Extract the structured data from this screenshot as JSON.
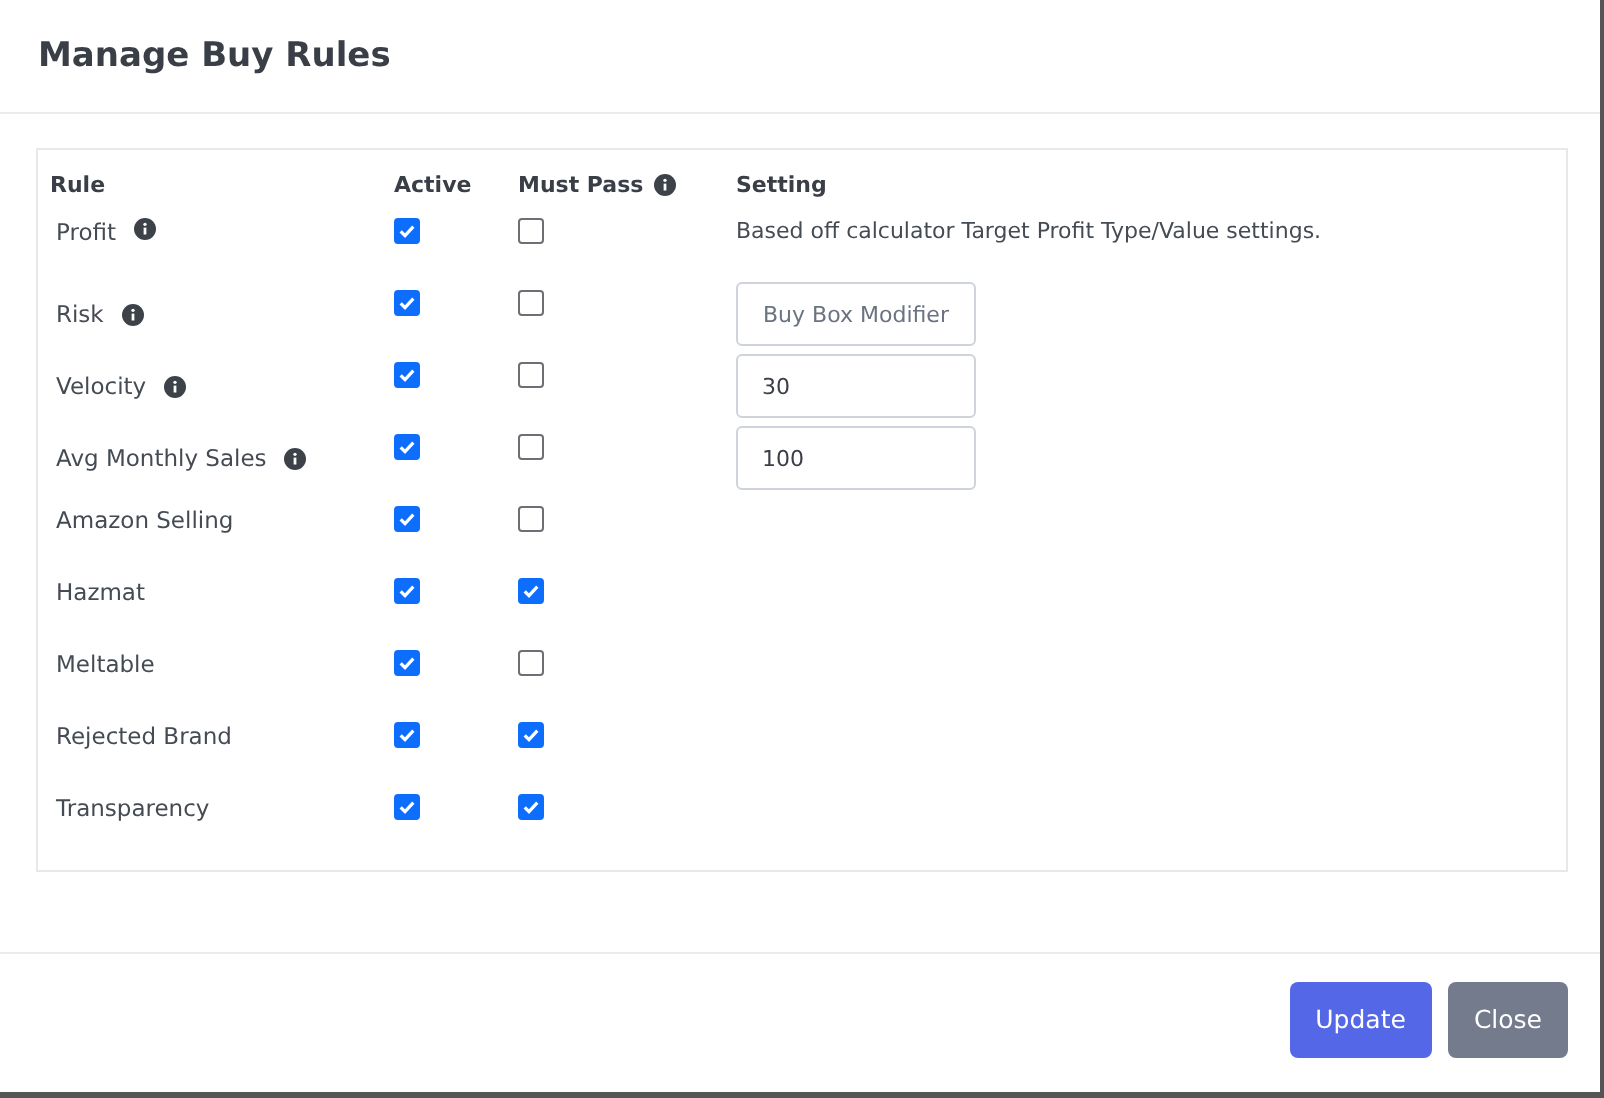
{
  "modal": {
    "title": "Manage Buy Rules"
  },
  "table": {
    "columns": [
      {
        "label": "Rule",
        "info": false
      },
      {
        "label": "Active",
        "info": false
      },
      {
        "label": "Must Pass",
        "info": true
      },
      {
        "label": "Setting",
        "info": false
      }
    ],
    "rows": [
      {
        "rule": "Profit",
        "info": true,
        "active": true,
        "must_pass": false,
        "setting": {
          "kind": "text",
          "text": "Based off calculator Target Profit Type/Value settings."
        }
      },
      {
        "rule": "Risk",
        "info": true,
        "active": true,
        "must_pass": false,
        "setting": {
          "kind": "button",
          "label": "Buy Box Modifier"
        }
      },
      {
        "rule": "Velocity",
        "info": true,
        "active": true,
        "must_pass": false,
        "setting": {
          "kind": "input",
          "value": "30"
        }
      },
      {
        "rule": "Avg Monthly Sales",
        "info": true,
        "active": true,
        "must_pass": false,
        "setting": {
          "kind": "input",
          "value": "100"
        }
      },
      {
        "rule": "Amazon Selling",
        "info": false,
        "active": true,
        "must_pass": false
      },
      {
        "rule": "Hazmat",
        "info": false,
        "active": true,
        "must_pass": true
      },
      {
        "rule": "Meltable",
        "info": false,
        "active": true,
        "must_pass": false
      },
      {
        "rule": "Rejected Brand",
        "info": false,
        "active": true,
        "must_pass": true
      },
      {
        "rule": "Transparency",
        "info": false,
        "active": true,
        "must_pass": true
      }
    ]
  },
  "buttons": [
    {
      "label": "Update",
      "kind": "primary"
    },
    {
      "label": "Close",
      "kind": "secondary"
    }
  ]
}
